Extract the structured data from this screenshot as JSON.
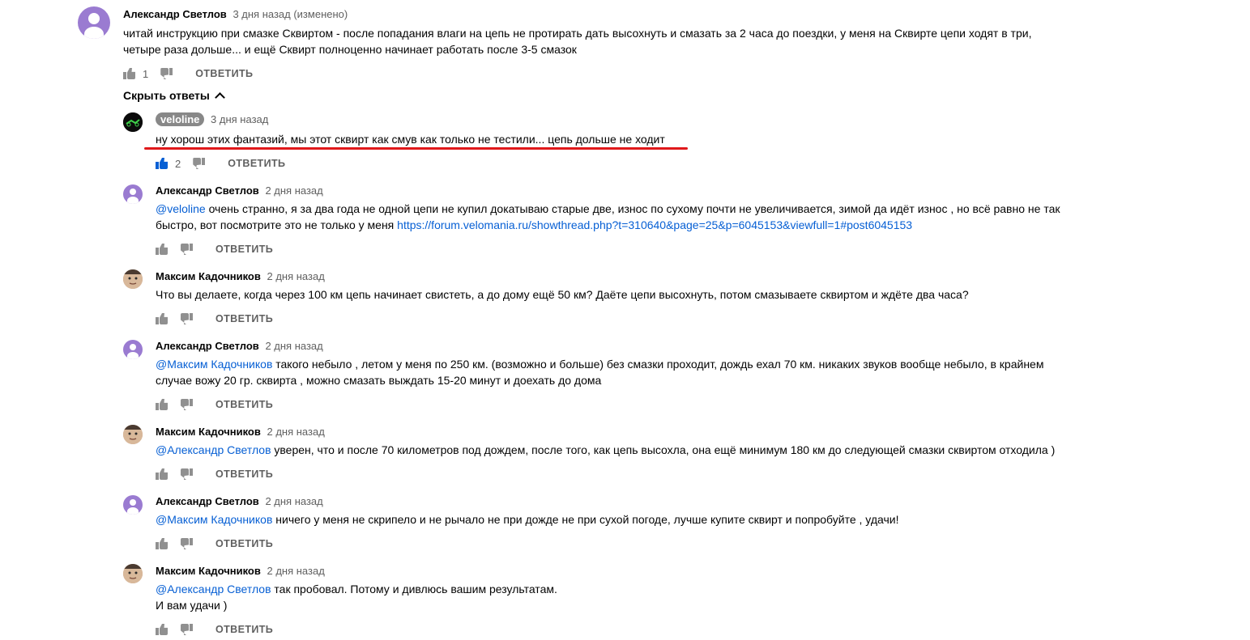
{
  "top_comment": {
    "author": "Александр Светлов",
    "time": "3 дня назад (изменено)",
    "text_line1": "читай инструкцию при смазке Сквиртом - после попадания влаги на цепь не протирать дать высохнуть и смазать за 2 часа до поездки, у меня на Сквирте цепи ходят в три,",
    "text_line2": "четыре раза дольше... и ещё Сквирт полноценно начинает работать после 3-5 смазок",
    "likes": "1",
    "reply_label": "ОТВЕТИТЬ"
  },
  "toggle": {
    "label": "Скрыть ответы"
  },
  "replies": [
    {
      "author": "veloline",
      "time": "3 дня назад",
      "mention": "",
      "line1": "ну хорош этих фантазий, мы этот сквирт как смув как только не тестили... цепь дольше не ходит",
      "line2": "",
      "link": "",
      "likes": "2",
      "reply_label": "ОТВЕТИТЬ"
    },
    {
      "author": "Александр Светлов",
      "time": "2 дня назад",
      "mention": "@veloline",
      "line1": " очень странно, я за два года не одной цепи не купил докатываю старые две, износ по сухому почти не увеличивается, зимой да идёт износ , но всё равно не так",
      "line2": "быстро, вот посмотрите это не только у меня ",
      "link": "https://forum.velomania.ru/showthread.php?t=310640&page=25&p=6045153&viewfull=1#post6045153",
      "likes": "",
      "reply_label": "ОТВЕТИТЬ"
    },
    {
      "author": "Максим Кадочников",
      "time": "2 дня назад",
      "mention": "",
      "line1": "Что вы делаете, когда через 100 км цепь начинает свистеть, а до дому ещё 50 км? Даёте цепи высохнуть, потом смазываете сквиртом и ждёте два часа?",
      "line2": "",
      "link": "",
      "likes": "",
      "reply_label": "ОТВЕТИТЬ"
    },
    {
      "author": "Александр Светлов",
      "time": "2 дня назад",
      "mention": "@Максим Кадочников",
      "line1": " такого небыло , летом у меня по 250 км. (возможно и больше) без смазки проходит, дождь ехал 70 км. никаких звуков вообще небыло, в крайнем",
      "line2": "случае вожу 20 гр. сквирта , можно смазать выждать 15-20 минут и доехать до дома",
      "link": "",
      "likes": "",
      "reply_label": "ОТВЕТИТЬ"
    },
    {
      "author": "Максим Кадочников",
      "time": "2 дня назад",
      "mention": "@Александр Светлов",
      "line1": " уверен, что и после 70 километров под дождем, после того, как цепь высохла, она ещё минимум 180 км до следующей смазки сквиртом отходила )",
      "line2": "",
      "link": "",
      "likes": "",
      "reply_label": "ОТВЕТИТЬ"
    },
    {
      "author": "Александр Светлов",
      "time": "2 дня назад",
      "mention": "@Максим Кадочников",
      "line1": " ничего у меня не скрипело и не рычало не при дожде не при сухой погоде, лучше купите сквирт и попробуйте , удачи!",
      "line2": "",
      "link": "",
      "likes": "",
      "reply_label": "ОТВЕТИТЬ"
    },
    {
      "author": "Максим Кадочников",
      "time": "2 дня назад",
      "mention": "@Александр Светлов",
      "line1": " так пробовал.  Потому и дивлюсь вашим результатам.",
      "line2": "И вам удачи )",
      "link": "",
      "likes": "",
      "reply_label": "ОТВЕТИТЬ"
    }
  ],
  "colors": {
    "link": "#065fd4",
    "highlight_line": "#e0191b",
    "avatar_purple": "#9a7bd1"
  }
}
